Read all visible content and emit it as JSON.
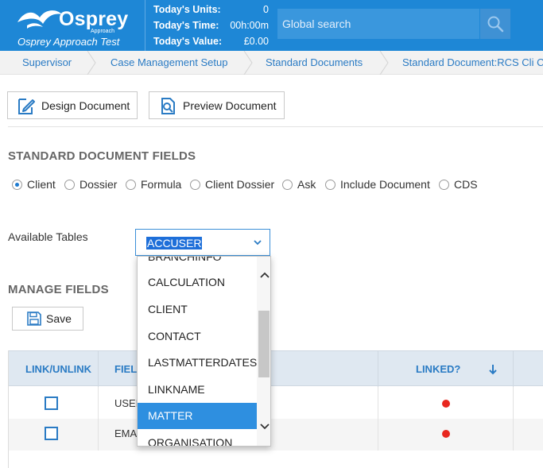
{
  "header": {
    "brand_name": "Osprey",
    "brand_sub": "Approach",
    "brand_tagline": "Osprey Approach Test",
    "stats": [
      {
        "label": "Today's Units:",
        "value": "0"
      },
      {
        "label": "Today's Time:",
        "value": "00h:00m"
      },
      {
        "label": "Today's Value:",
        "value": "£0.00"
      }
    ],
    "search_placeholder": "Global search",
    "search_icon": "search-icon"
  },
  "breadcrumb": [
    {
      "label": "Supervisor"
    },
    {
      "label": "Case Management Setup"
    },
    {
      "label": "Standard Documents"
    },
    {
      "label": "Standard Document:RCS Cli Co"
    }
  ],
  "toolbar": {
    "design_label": "Design Document",
    "preview_label": "Preview Document"
  },
  "fields_section": {
    "title": "STANDARD DOCUMENT FIELDS",
    "radios": [
      {
        "label": "Client",
        "checked": true
      },
      {
        "label": "Dossier",
        "checked": false
      },
      {
        "label": "Formula",
        "checked": false
      },
      {
        "label": "Client Dossier",
        "checked": false
      },
      {
        "label": "Ask",
        "checked": false
      },
      {
        "label": "Include Document",
        "checked": false
      },
      {
        "label": "CDS",
        "checked": false
      }
    ],
    "available_tables_label": "Available Tables",
    "selected_table": "ACCUSER",
    "table_options": [
      "BRANCHINFO",
      "CALCULATION",
      "CLIENT",
      "CONTACT",
      "LASTMATTERDATES",
      "LINKNAME",
      "MATTER",
      "ORGANISATION"
    ],
    "highlighted_option": "MATTER"
  },
  "manage_section": {
    "title": "MANAGE FIELDS",
    "save_label": "Save",
    "columns": [
      "LINK/UNLINK",
      "FIEL",
      "LINKED?"
    ],
    "rows": [
      {
        "field": "USEF",
        "linked": true
      },
      {
        "field": "EMA",
        "linked": true
      }
    ]
  },
  "colors": {
    "header_bg": "#1e87d6",
    "link": "#2a7bc4",
    "selected_option": "#2e8fe0",
    "linked_dot": "#e8271f"
  }
}
